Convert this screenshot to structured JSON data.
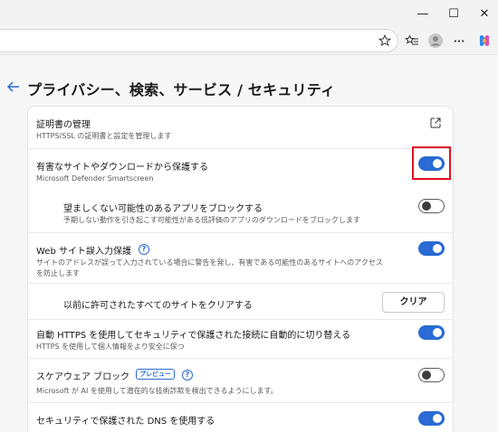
{
  "window": {
    "minimize_glyph": "—",
    "maximize_glyph": "☐",
    "close_glyph": "✕"
  },
  "toolbar": {
    "icons": [
      "star-icon",
      "favorites-icon",
      "profile-avatar",
      "more-icon",
      "copilot-icon"
    ],
    "more_glyph": "···"
  },
  "page": {
    "title": "プライバシー、検索、サービス / セキュリティ"
  },
  "settings": {
    "cert": {
      "label": "証明書の管理",
      "desc": "HTTPS/SSL の証明書と設定を管理します"
    },
    "harmful": {
      "label": "有害なサイトやダウンロードから保護する",
      "desc": "Microsoft Defender Smartscreen",
      "on": true
    },
    "pua": {
      "label": "望ましくない可能性のあるアプリをブロックする",
      "desc": "予期しない動作を引き起こす可能性がある低評価のアプリのダウンロードをブロックします",
      "on": false
    },
    "typo": {
      "label": "Web サイト誤入力保護",
      "desc_line1": "サイトのアドレスが誤って入力されている場合に警告を発し、有害である可能性のあるサイトへのアクセス",
      "desc_line2": "を防止します",
      "on": true
    },
    "clear_allowed": {
      "label": "以前に許可されたすべてのサイトをクリアする",
      "button": "クリア"
    },
    "https": {
      "label": "自動 HTTPS を使用してセキュリティで保護された接続に自動的に切り替える",
      "desc": "HTTPS を使用して個人情報をより安全に保つ",
      "on": true
    },
    "scareware": {
      "label": "スケアウェア ブロック",
      "badge": "プレビュー",
      "desc": "Microsoft が AI を使用して潜在的な技術詐欺を検出できるようにします。",
      "on": false
    },
    "dns": {
      "label": "セキュリティで保護された DNS を使用する",
      "on": true
    }
  },
  "colors": {
    "accent": "#2a6ad4",
    "highlight": "#e01020"
  }
}
